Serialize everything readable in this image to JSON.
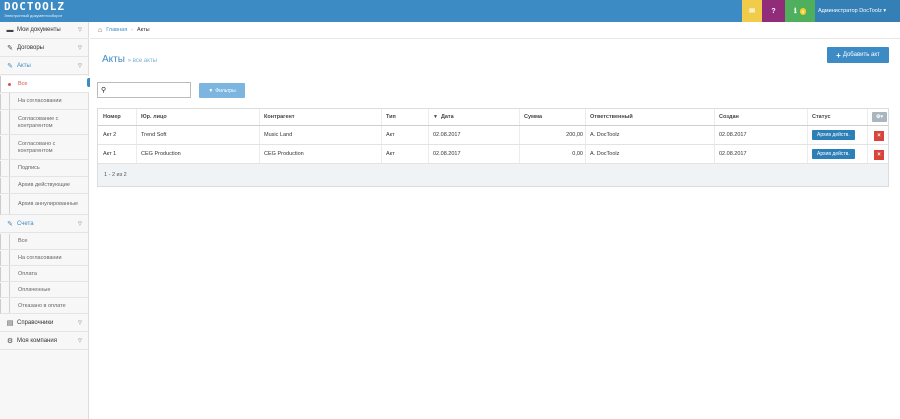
{
  "topbar": {
    "brand": "DOCTOOLZ",
    "subtitle": "Электронный документооборот",
    "notify_count": "0",
    "user_label": "Администратор DocToolz ▾"
  },
  "sidebar": {
    "sections": [
      {
        "label": "Мои документы",
        "icon": "briefcase-icon"
      },
      {
        "label": "Договоры",
        "icon": "pencil-icon"
      },
      {
        "label": "Акты",
        "icon": "pencil-icon"
      },
      {
        "label": "Счета",
        "icon": "pencil-icon"
      },
      {
        "label": "Справочники",
        "icon": "book-icon"
      },
      {
        "label": "Моя компания",
        "icon": "gear-icon"
      }
    ],
    "acts_items": [
      "Все",
      "На согласовании",
      "Согласование с контрагентом",
      "Согласовано с контрагентом",
      "Подпись",
      "Архив действующие",
      "Архив аннулированные"
    ],
    "invoices_items": [
      "Все",
      "На согласовании",
      "Оплата",
      "Оплаченные",
      "Отказано в оплате"
    ]
  },
  "breadcrumb": {
    "home": "Главная",
    "current": "Акты"
  },
  "page": {
    "title": "Акты",
    "subtitle": "все акты",
    "add_button": "Добавить акт",
    "search_value": "",
    "filters_button": "Фильтры"
  },
  "table": {
    "headers": {
      "number": "Номер",
      "legal": "Юр. лицо",
      "contractor": "Контрагент",
      "type": "Тип",
      "date": "Дата",
      "sum": "Сумма",
      "responsible": "Ответственный",
      "created": "Создан",
      "status": "Статус"
    },
    "rows": [
      {
        "number": "Акт 2",
        "legal": "Trend Soft",
        "contractor": "Music Land",
        "type": "Акт",
        "date": "02.08.2017",
        "sum": "200,00",
        "responsible": "A. DocToolz",
        "created": "02.08.2017",
        "status": "Архив действ."
      },
      {
        "number": "Акт 1",
        "legal": "CEG Production",
        "contractor": "CEG Production",
        "type": "Акт",
        "date": "02.08.2017",
        "sum": "0,00",
        "responsible": "A. DocToolz",
        "created": "02.08.2017",
        "status": "Архив действ."
      }
    ],
    "pagination": "1 - 2 из 2"
  },
  "colors": {
    "accent": "#3d8bc5",
    "mail": "#f1cc4b",
    "help": "#912c7a",
    "notify": "#4eb05c",
    "danger": "#d9443a"
  }
}
